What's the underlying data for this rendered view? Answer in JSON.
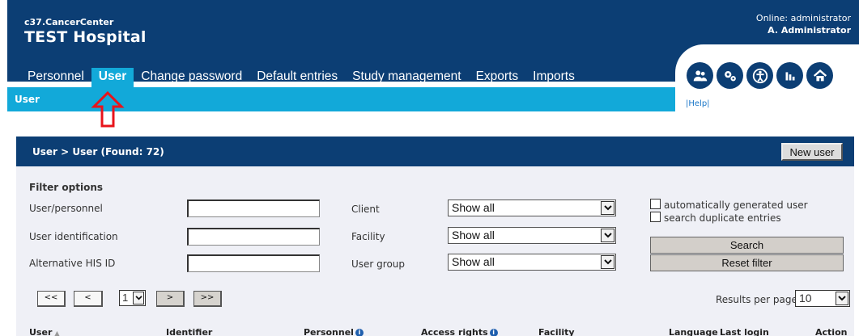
{
  "header": {
    "brand_sub": "c37.CancerCenter",
    "brand_title": "TEST Hospital",
    "online_line": "Online: administrator",
    "user_name": "A. Administrator"
  },
  "nav": {
    "items": [
      {
        "label": "Personnel",
        "active": false
      },
      {
        "label": "User",
        "active": true
      },
      {
        "label": "Change password",
        "active": false
      },
      {
        "label": "Default entries",
        "active": false
      },
      {
        "label": "Study management",
        "active": false
      },
      {
        "label": "Exports",
        "active": false
      },
      {
        "label": "Imports",
        "active": false
      }
    ],
    "sub_item": "User"
  },
  "toolbar": {
    "icons": [
      "users-icon",
      "settings-icon",
      "accessibility-icon",
      "statistics-icon",
      "home-icon"
    ],
    "help_label": "|Help|"
  },
  "main": {
    "title": "User > User (Found: 72)",
    "new_user_label": "New user"
  },
  "filter": {
    "title": "Filter options",
    "user_personnel_label": "User/personnel",
    "user_identification_label": "User identification",
    "alt_his_label": "Alternative HIS ID",
    "user_personnel_value": "",
    "user_identification_value": "",
    "alt_his_value": "",
    "client_label": "Client",
    "facility_label": "Facility",
    "user_group_label": "User group",
    "client_value": "Show all",
    "facility_value": "Show all",
    "user_group_value": "Show all",
    "auto_generated_label": "automatically generated user",
    "duplicates_label": "search duplicate entries",
    "search_label": "Search",
    "reset_label": "Reset filter"
  },
  "pager": {
    "first": "<<",
    "prev": "<",
    "page": "1",
    "next": ">",
    "last": ">>",
    "results_label": "Results per page",
    "results_value": "10"
  },
  "table": {
    "columns": [
      "User",
      "Identifier",
      "Personnel",
      "Access rights",
      "Facility",
      "Language",
      "Last login",
      "Action"
    ]
  },
  "colors": {
    "navy": "#0c3e74",
    "cyan": "#12a9d9",
    "filter_bg": "#eff0f6",
    "annotation_red": "#e8141b"
  }
}
